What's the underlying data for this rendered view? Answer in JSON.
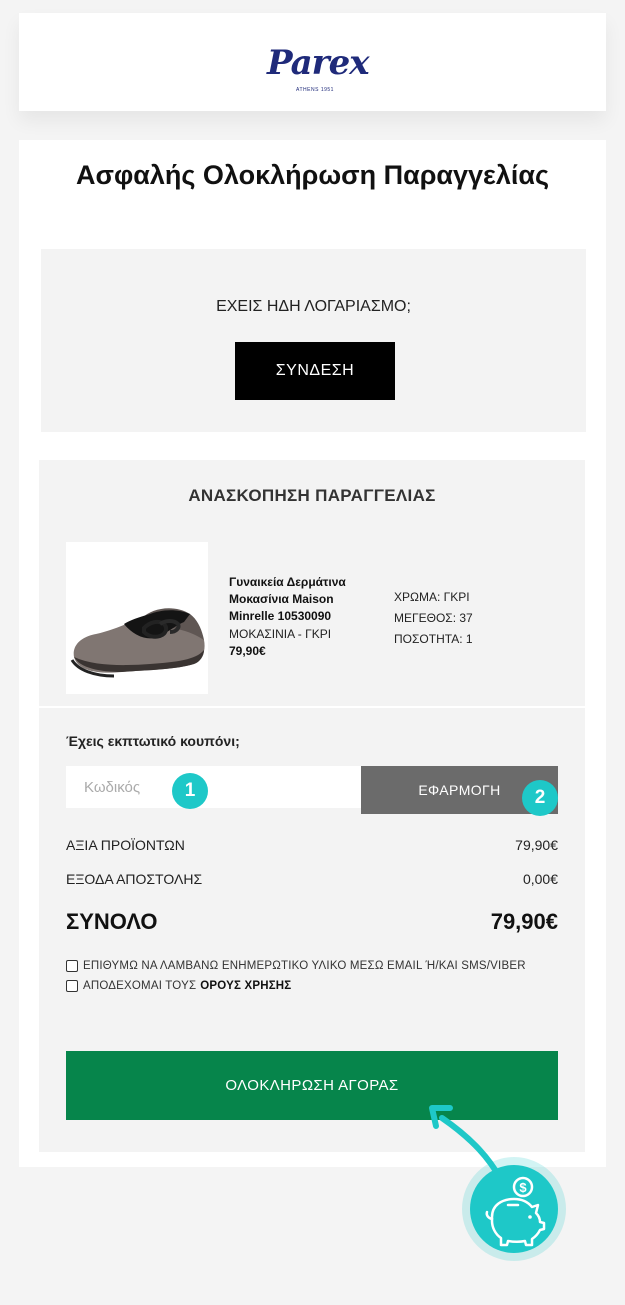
{
  "brand": {
    "logo_text": "Parex",
    "logo_sub": "ATHENS 1951"
  },
  "page": {
    "title": "Ασφαλής Ολοκλήρωση Παραγγελίας"
  },
  "login": {
    "question": "ΕΧΕΙΣ ΗΔΗ ΛΟΓΑΡΙΑΣΜΟ;",
    "button": "ΣΥΝΔΕΣΗ"
  },
  "review": {
    "title": "ΑΝΑΣΚΟΠΗΣΗ ΠΑΡΑΓΓΕΛΙΑΣ",
    "product": {
      "name": "Γυναικεία Δερμάτινα Μοκασίνια Maison Minrelle 10530090",
      "category": "ΜΟΚΑΣΙΝΙΑ - ΓΚΡΙ",
      "price": "79,90€",
      "color": "ΧΡΩΜΑ: ΓΚΡΙ",
      "size": "ΜΕΓΕΘΟΣ: 37",
      "quantity": "ΠΟΣΟΤΗΤΑ: 1"
    }
  },
  "coupon": {
    "label": "Έχεις εκπτωτικό κουπόνι;",
    "placeholder": "Κωδικός",
    "button": "ΕΦΑΡΜΟΓΗ",
    "marker_input": "1",
    "marker_button": "2"
  },
  "summary": {
    "products_label": "ΑΞΙΑ ΠΡΟΪΟΝΤΩΝ",
    "products_value": "79,90€",
    "shipping_label": "ΕΞΟΔΑ ΑΠΟΣΤΟΛΗΣ",
    "shipping_value": "0,00€",
    "total_label": "ΣΥΝΟΛΟ",
    "total_value": "79,90€"
  },
  "consents": {
    "newsletter": "ΕΠΙΘΥΜΩ ΝΑ ΛΑΜΒΑΝΩ ΕΝΗΜΕΡΩΤΙΚΟ ΥΛΙΚΟ ΜΕΣΩ EMAIL Ή/ΚΑΙ SMS/VIBER",
    "terms_prefix": "ΑΠΟΔΕΧΟΜΑΙ ΤΟΥΣ",
    "terms_link": "ΟΡΟΥΣ ΧΡΗΣΗΣ"
  },
  "checkout": {
    "button": "ΟΛΟΚΛΗΡΩΣΗ ΑΓΟΡΑΣ"
  },
  "colors": {
    "accent_teal": "#1ec8c8",
    "buy_green": "#06854b",
    "brand_navy": "#1f2a7a"
  },
  "icons": {
    "badge": "piggy-bank-icon",
    "pointer": "curved-arrow-icon"
  }
}
